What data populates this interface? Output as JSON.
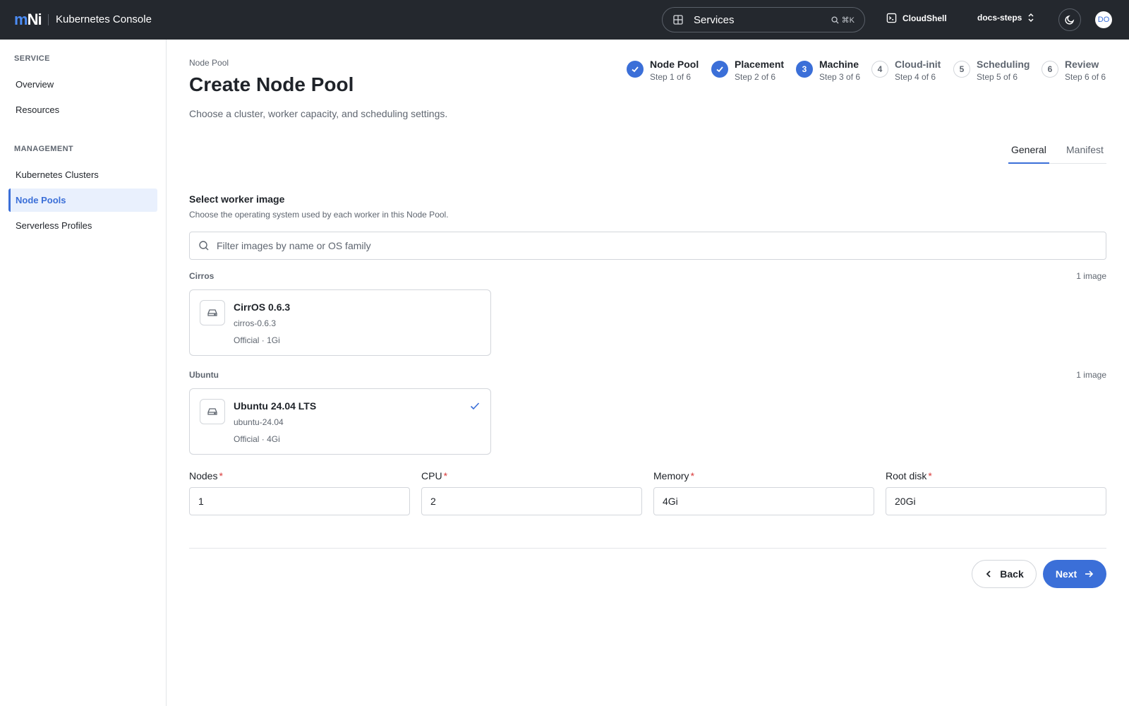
{
  "header": {
    "logo_m": "m",
    "logo_n": "Ni",
    "app_title": "Kubernetes Console",
    "services_label": "Services",
    "services_shortcut": "⌘K",
    "cloudshell_label": "CloudShell",
    "project_label": "docs-steps",
    "avatar_initials": "DO"
  },
  "sidebar": {
    "sections": [
      {
        "title": "SERVICE",
        "items": [
          "Overview",
          "Resources"
        ]
      },
      {
        "title": "MANAGEMENT",
        "items": [
          "Kubernetes Clusters",
          "Node Pools",
          "Serverless Profiles"
        ]
      }
    ],
    "active_item": "Node Pools"
  },
  "page": {
    "breadcrumb": "Node Pool",
    "title": "Create Node Pool",
    "subtitle": "Choose a cluster, worker capacity, and scheduling settings."
  },
  "stepper": [
    {
      "number": "1",
      "label": "Node Pool",
      "sub": "Step 1 of 6",
      "state": "done"
    },
    {
      "number": "2",
      "label": "Placement",
      "sub": "Step 2 of 6",
      "state": "done"
    },
    {
      "number": "3",
      "label": "Machine",
      "sub": "Step 3 of 6",
      "state": "current"
    },
    {
      "number": "4",
      "label": "Cloud-init",
      "sub": "Step 4 of 6",
      "state": "todo"
    },
    {
      "number": "5",
      "label": "Scheduling",
      "sub": "Step 5 of 6",
      "state": "todo"
    },
    {
      "number": "6",
      "label": "Review",
      "sub": "Step 6 of 6",
      "state": "todo"
    }
  ],
  "tabs": [
    {
      "label": "General",
      "active": true
    },
    {
      "label": "Manifest",
      "active": false
    }
  ],
  "image_section": {
    "title": "Select worker image",
    "description": "Choose the operating system used by each worker in this Node Pool.",
    "filter_placeholder": "Filter images by name or OS family",
    "groups": [
      {
        "label": "Cirros",
        "count": "1 image",
        "images": [
          {
            "name": "CirrOS 0.6.3",
            "slug": "cirros-0.6.3",
            "meta": "Official · 1Gi",
            "selected": false
          }
        ]
      },
      {
        "label": "Ubuntu",
        "count": "1 image",
        "images": [
          {
            "name": "Ubuntu 24.04 LTS",
            "slug": "ubuntu-24.04",
            "meta": "Official · 4Gi",
            "selected": true
          }
        ]
      }
    ]
  },
  "fields": [
    {
      "label": "Nodes",
      "required_mark": "*",
      "value": "1"
    },
    {
      "label": "CPU",
      "required_mark": "*",
      "value": "2"
    },
    {
      "label": "Memory",
      "required_mark": "*",
      "value": "4Gi"
    },
    {
      "label": "Root disk",
      "required_mark": "*",
      "value": "20Gi"
    }
  ],
  "actions": {
    "back_label": "Back",
    "next_label": "Next"
  },
  "colors": {
    "accent": "#3b6fd8",
    "topbar": "#24282e",
    "required": "#d93a3a"
  }
}
